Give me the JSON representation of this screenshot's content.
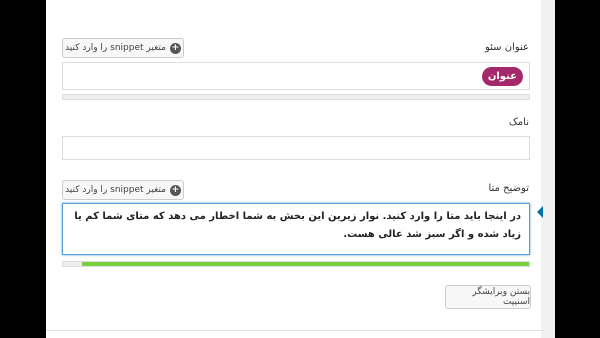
{
  "seo_title": {
    "label": "عنوان سئو",
    "insert_button": "متغیر snippet را وارد کنید",
    "pill": "عنوان",
    "progress": 0
  },
  "slug": {
    "label": "نامک",
    "value": ""
  },
  "meta_description": {
    "label": "توضیح متا",
    "insert_button": "متغیر snippet را وارد کنید",
    "value": "در اینجا باید متا را وارد کنید. نوار زیرین این بخش به شما اخطار می دهد که متای شما کم یا زیاد شده و اگر سبز شد عالی هست.",
    "progress": 0.96
  },
  "close_button": "بستن ویرایشگر اسنیپت",
  "colors": {
    "pill": "#a4286a",
    "progress_good": "#7ad03a",
    "focus_border": "#5b9dd9"
  }
}
